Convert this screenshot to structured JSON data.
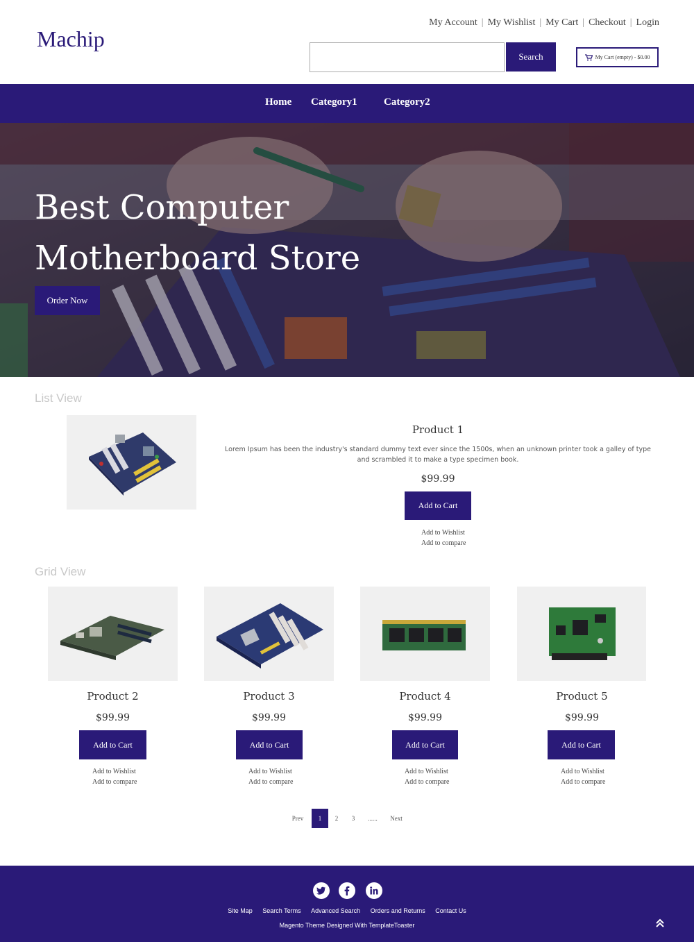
{
  "header": {
    "logo": "Machip",
    "toplinks": [
      "My Account",
      "My Wishlist",
      "My Cart",
      "Checkout",
      "Login"
    ],
    "search_placeholder": "",
    "search_button": "Search",
    "mini_cart": "My Cart (empty) - $0.00"
  },
  "nav": {
    "items": [
      "Home",
      "Category1",
      "Category2"
    ]
  },
  "hero": {
    "title_line1": "Best Computer",
    "title_line2": "Motherboard Store",
    "button": "Order Now"
  },
  "list_view": {
    "label": "List View",
    "product": {
      "title": "Product 1",
      "description": "Lorem Ipsum has been the industry's standard dummy text ever since the 1500s, when an unknown printer took a galley of type and scrambled it to make a type specimen book.",
      "price": "$99.99",
      "cart_button": "Add to Cart",
      "wishlist": "Add to Wishlist",
      "compare": "Add to compare"
    }
  },
  "grid_view": {
    "label": "Grid View",
    "products": [
      {
        "title": "Product 2",
        "price": "$99.99",
        "cart_button": "Add to Cart",
        "wishlist": "Add to Wishlist",
        "compare": "Add to compare"
      },
      {
        "title": "Product 3",
        "price": "$99.99",
        "cart_button": "Add to Cart",
        "wishlist": "Add to Wishlist",
        "compare": "Add to compare"
      },
      {
        "title": "Product 4",
        "price": "$99.99",
        "cart_button": "Add to Cart",
        "wishlist": "Add to Wishlist",
        "compare": "Add to compare"
      },
      {
        "title": "Product 5",
        "price": "$99.99",
        "cart_button": "Add to Cart",
        "wishlist": "Add to Wishlist",
        "compare": "Add to compare"
      }
    ]
  },
  "pagination": {
    "prev": "Prev",
    "pages": [
      "1",
      "2",
      "3"
    ],
    "ellipsis": "......",
    "next": "Next",
    "active": "1"
  },
  "footer": {
    "social": [
      "twitter-icon",
      "facebook-icon",
      "linkedin-icon"
    ],
    "links": [
      "Site Map",
      "Search Terms",
      "Advanced Search",
      "Orders and Returns",
      "Contact Us"
    ],
    "credit": "Magento Theme Designed With TemplateToaster"
  },
  "colors": {
    "brand": "#2a1a78",
    "image_bg": "#f0f0f0"
  }
}
